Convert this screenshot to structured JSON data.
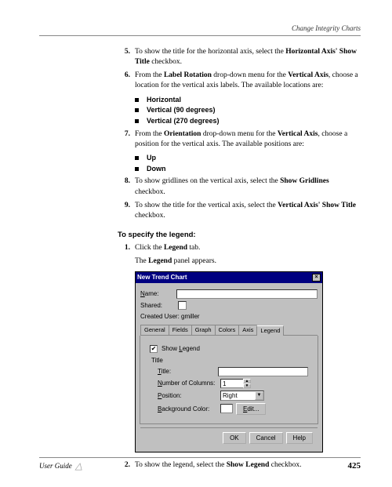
{
  "header": {
    "title": "Change Integrity Charts"
  },
  "steps_a": [
    {
      "num": "5.",
      "html": "To show the title for the horizontal axis, select the <b>Horizontal Axis' Show Title</b> checkbox."
    },
    {
      "num": "6.",
      "html": "From the <b>Label Rotation</b> drop-down menu for the <b>Vertical Axis</b>, choose a location for the vertical axis labels. The available locations are:",
      "bullets": [
        "Horizontal",
        "Vertical (90 degrees)",
        "Vertical (270 degrees)"
      ]
    },
    {
      "num": "7.",
      "html": "From the <b>Orientation</b> drop-down menu for the <b>Vertical Axis</b>, choose a position for the vertical axis. The available positions are:",
      "bullets": [
        "Up",
        "Down"
      ]
    },
    {
      "num": "8.",
      "html": "To show gridlines on the vertical axis, select the <b>Show Gridlines</b> checkbox."
    },
    {
      "num": "9.",
      "html": "To show the title for the vertical axis, select the <b>Vertical Axis' Show Title</b> checkbox."
    }
  ],
  "section_b_heading": "To specify the legend:",
  "steps_b": [
    {
      "num": "1.",
      "html": "Click the <b>Legend</b> tab.",
      "after": "The <b>Legend</b> panel appears."
    }
  ],
  "dialog": {
    "title": "New Trend Chart",
    "name_label": "Name:",
    "shared_label": "Shared:",
    "created_user_label": "Created User:",
    "created_user_value": "gmiller",
    "tabs": [
      "General",
      "Fields",
      "Graph",
      "Colors",
      "Axis",
      "Legend"
    ],
    "show_legend": "Show Legend",
    "group_title": "Title",
    "title_label": "Title:",
    "numcols_label": "Number of Columns:",
    "numcols_value": "1",
    "position_label": "Position:",
    "position_value": "Right",
    "bgcolor_label": "Background Color:",
    "edit_btn": "Edit...",
    "buttons": {
      "ok": "OK",
      "cancel": "Cancel",
      "help": "Help"
    }
  },
  "step_b2": {
    "num": "2.",
    "html": "To show the legend, select the <b>Show Legend</b> checkbox."
  },
  "footer": {
    "left": "User Guide",
    "page": "425"
  }
}
